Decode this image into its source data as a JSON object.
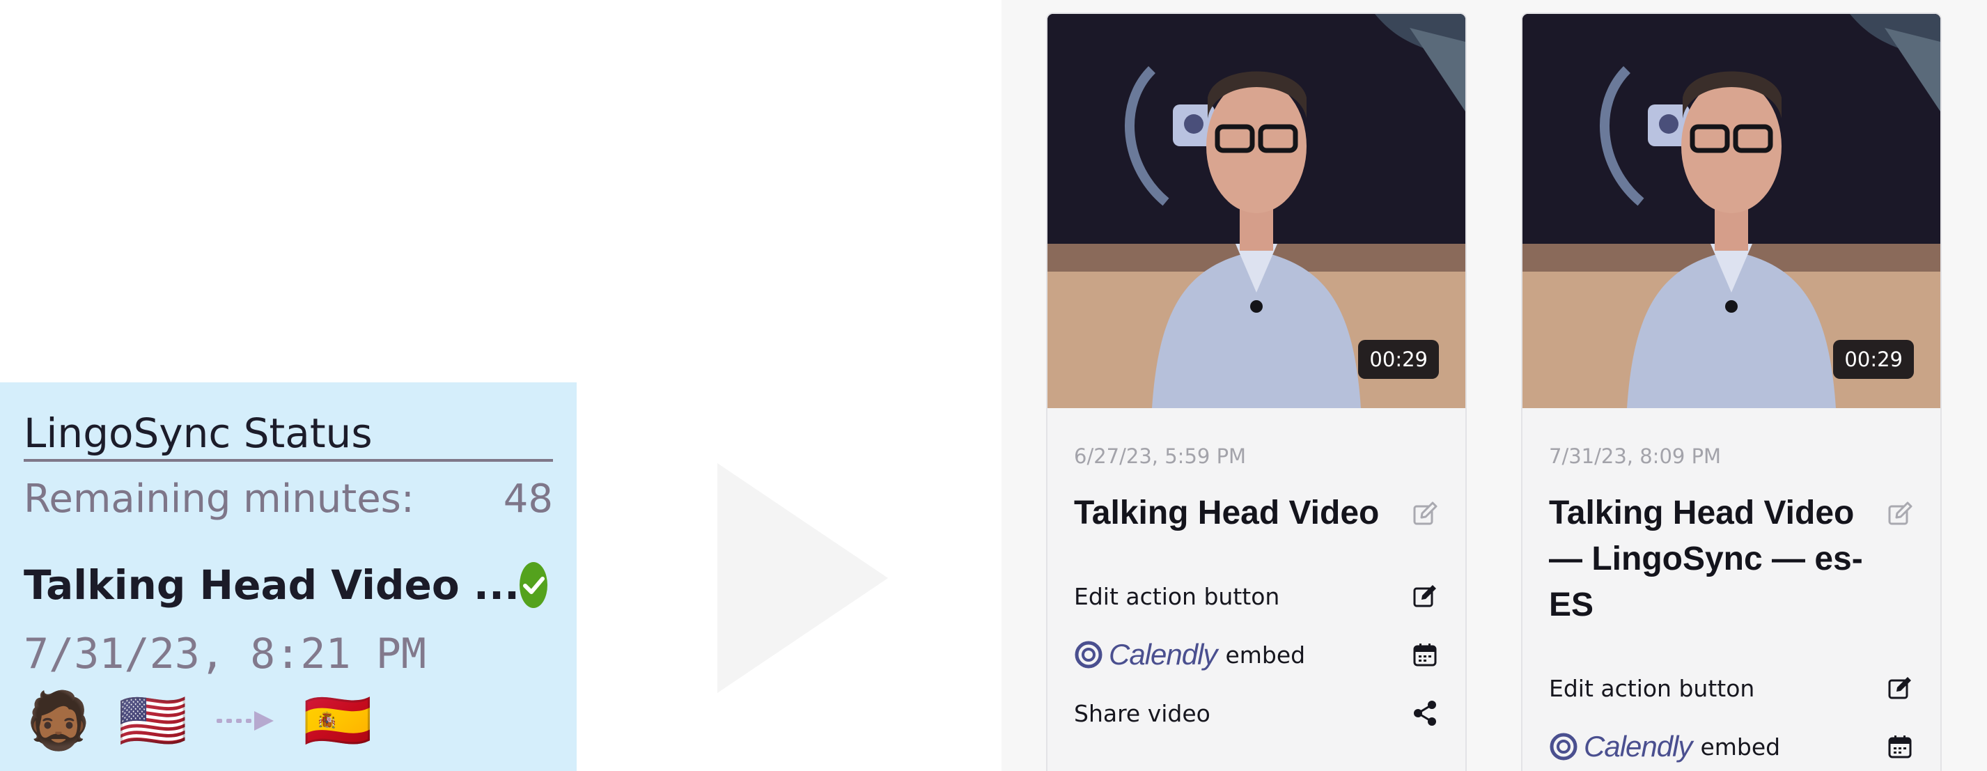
{
  "status_panel": {
    "title": "LingoSync Status",
    "remaining_label": "Remaining minutes:",
    "remaining_value": "48",
    "job": {
      "title": "Talking Head Video ...",
      "date": "7/31/23, 8:21 PM",
      "status_icon": "check-circle-icon",
      "status_color": "#54a21d",
      "voice_emoji": "🧔🏾",
      "source_flag": "🇺🇸",
      "arrow": "⇢",
      "target_flag": "🇪🇸"
    },
    "background": "#d5eefb"
  },
  "gallery": {
    "cards": [
      {
        "duration": "00:29",
        "date": "6/27/23, 5:59 PM",
        "title": "Talking Head Video",
        "actions": [
          {
            "label": "Edit action button",
            "icon": "edit-icon"
          },
          {
            "label": "Calendly",
            "suffix": "embed",
            "icon": "calendar-icon"
          },
          {
            "label": "Share video",
            "icon": "share-icon"
          }
        ]
      },
      {
        "duration": "00:29",
        "date": "7/31/23, 8:09 PM",
        "title": "Talking Head Video — LingoSync — es-ES",
        "actions": [
          {
            "label": "Edit action button",
            "icon": "edit-icon"
          },
          {
            "label": "Calendly",
            "suffix": "embed",
            "icon": "calendar-icon"
          }
        ]
      }
    ]
  }
}
